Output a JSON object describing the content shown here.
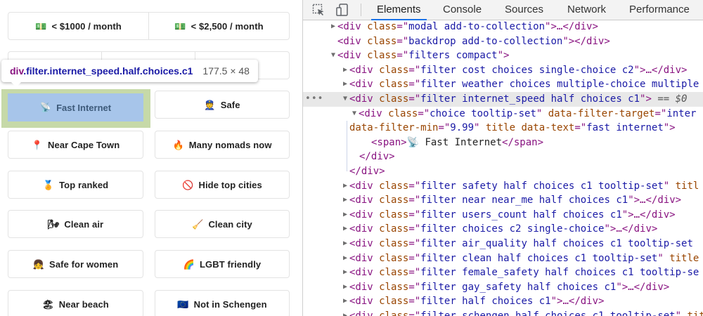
{
  "page": {
    "filters": [
      {
        "id": "cost1",
        "icon": "💵",
        "label": "< $1000 / month"
      },
      {
        "id": "cost2",
        "icon": "💵",
        "label": "< $2,500 / month"
      },
      {
        "id": "fast-internet",
        "icon": "📡",
        "label": "Fast Internet"
      },
      {
        "id": "safe",
        "icon": "👮",
        "label": "Safe"
      },
      {
        "id": "near-cape-town",
        "icon": "📍",
        "label": "Near Cape Town"
      },
      {
        "id": "many-nomads",
        "icon": "🔥",
        "label": "Many nomads now"
      },
      {
        "id": "top-ranked",
        "icon": "🏅",
        "label": "Top ranked"
      },
      {
        "id": "hide-top-cities",
        "icon": "🚫",
        "label": "Hide top cities"
      },
      {
        "id": "clean-air",
        "icon": "🌬",
        "label": "Clean air"
      },
      {
        "id": "clean-city",
        "icon": "🧹",
        "label": "Clean city"
      },
      {
        "id": "safe-for-women",
        "icon": "👧",
        "label": "Safe for women"
      },
      {
        "id": "lgbt-friendly",
        "icon": "🌈",
        "label": "LGBT friendly"
      },
      {
        "id": "near-beach",
        "icon": "🏖",
        "label": "Near beach"
      },
      {
        "id": "not-in-schengen",
        "icon": "🇪🇺",
        "label": "Not in Schengen"
      }
    ]
  },
  "inspect_tooltip": {
    "tag": "div",
    "classes": ".filter.internet_speed.half.choices.c1",
    "dimensions": "177.5 × 48"
  },
  "devtools": {
    "tabs": [
      "Elements",
      "Console",
      "Sources",
      "Network",
      "Performance"
    ],
    "active_tab": "Elements",
    "dom_lines": [
      {
        "indent": 1,
        "tri": "right",
        "parts": [
          [
            "t",
            "<div "
          ],
          [
            "an",
            "class"
          ],
          [
            "t",
            "=\""
          ],
          [
            "av",
            "modal add-to-collection"
          ],
          [
            "t",
            "\">…</div>"
          ]
        ]
      },
      {
        "indent": 1,
        "tri": "",
        "parts": [
          [
            "t",
            "<div "
          ],
          [
            "an",
            "class"
          ],
          [
            "t",
            "=\""
          ],
          [
            "av",
            "backdrop add-to-collection"
          ],
          [
            "t",
            "\"></div>"
          ]
        ]
      },
      {
        "indent": 0,
        "tri": "down",
        "parts": [
          [
            "t",
            "<div "
          ],
          [
            "an",
            "class"
          ],
          [
            "t",
            "=\""
          ],
          [
            "av",
            "filters compact"
          ],
          [
            "t",
            "\">"
          ]
        ]
      },
      {
        "indent": 2,
        "tri": "right",
        "parts": [
          [
            "t",
            "<div "
          ],
          [
            "an",
            "class"
          ],
          [
            "t",
            "=\""
          ],
          [
            "av",
            "filter cost choices single-choice c2"
          ],
          [
            "t",
            "\">…</div>"
          ]
        ]
      },
      {
        "indent": 2,
        "tri": "right",
        "parts": [
          [
            "t",
            "<div "
          ],
          [
            "an",
            "class"
          ],
          [
            "t",
            "=\""
          ],
          [
            "av",
            "filter weather choices multiple-choice multiple"
          ]
        ]
      },
      {
        "indent": 2,
        "tri": "down",
        "selected": true,
        "parts": [
          [
            "t",
            "<div "
          ],
          [
            "an",
            "class"
          ],
          [
            "t",
            "=\""
          ],
          [
            "av",
            "filter internet_speed half choices c1"
          ],
          [
            "t",
            "\">"
          ],
          [
            "eq",
            " == $0"
          ]
        ]
      },
      {
        "indent": 3,
        "tri": "down",
        "parts": [
          [
            "t",
            "<div "
          ],
          [
            "an",
            "class"
          ],
          [
            "t",
            "=\""
          ],
          [
            "av",
            "choice tooltip-set"
          ],
          [
            "t",
            "\" "
          ],
          [
            "an",
            "data-filter-target"
          ],
          [
            "t",
            "=\""
          ],
          [
            "av",
            "inter"
          ]
        ]
      },
      {
        "indent": 4,
        "tri": "",
        "parts": [
          [
            "an",
            "data-filter-min"
          ],
          [
            "t",
            "=\""
          ],
          [
            "av",
            "9.99"
          ],
          [
            "t",
            "\" "
          ],
          [
            "an",
            "title data-text"
          ],
          [
            "t",
            "=\""
          ],
          [
            "av",
            "fast internet"
          ],
          [
            "t",
            "\">"
          ]
        ]
      },
      {
        "indent": 5,
        "tri": "",
        "parts": [
          [
            "t",
            "<span>"
          ],
          [
            "x",
            "📡 Fast Internet"
          ],
          [
            "t",
            "</span>"
          ]
        ]
      },
      {
        "indent": 6,
        "tri": "",
        "parts": [
          [
            "t",
            "</div>"
          ]
        ]
      },
      {
        "indent": 7,
        "tri": "",
        "parts": [
          [
            "t",
            "</div>"
          ]
        ]
      },
      {
        "indent": 2,
        "tri": "right",
        "parts": [
          [
            "t",
            "<div "
          ],
          [
            "an",
            "class"
          ],
          [
            "t",
            "=\""
          ],
          [
            "av",
            "filter safety half choices c1 tooltip-set"
          ],
          [
            "t",
            "\" "
          ],
          [
            "an",
            "titl"
          ]
        ]
      },
      {
        "indent": 2,
        "tri": "right",
        "parts": [
          [
            "t",
            "<div "
          ],
          [
            "an",
            "class"
          ],
          [
            "t",
            "=\""
          ],
          [
            "av",
            "filter near near_me half choices c1"
          ],
          [
            "t",
            "\">…</div>"
          ]
        ]
      },
      {
        "indent": 2,
        "tri": "right",
        "parts": [
          [
            "t",
            "<div "
          ],
          [
            "an",
            "class"
          ],
          [
            "t",
            "=\""
          ],
          [
            "av",
            "filter users_count half choices c1"
          ],
          [
            "t",
            "\">…</div>"
          ]
        ]
      },
      {
        "indent": 2,
        "tri": "right",
        "parts": [
          [
            "t",
            "<div "
          ],
          [
            "an",
            "class"
          ],
          [
            "t",
            "=\""
          ],
          [
            "av",
            "filter choices c2 single-choice"
          ],
          [
            "t",
            "\">…</div>"
          ]
        ]
      },
      {
        "indent": 2,
        "tri": "right",
        "parts": [
          [
            "t",
            "<div "
          ],
          [
            "an",
            "class"
          ],
          [
            "t",
            "=\""
          ],
          [
            "av",
            "filter air_quality half choices c1 tooltip-set"
          ]
        ]
      },
      {
        "indent": 2,
        "tri": "right",
        "parts": [
          [
            "t",
            "<div "
          ],
          [
            "an",
            "class"
          ],
          [
            "t",
            "=\""
          ],
          [
            "av",
            "filter clean half choices c1 tooltip-set"
          ],
          [
            "t",
            "\" "
          ],
          [
            "an",
            "title"
          ]
        ]
      },
      {
        "indent": 2,
        "tri": "right",
        "parts": [
          [
            "t",
            "<div "
          ],
          [
            "an",
            "class"
          ],
          [
            "t",
            "=\""
          ],
          [
            "av",
            "filter female_safety half choices c1 tooltip-se"
          ]
        ]
      },
      {
        "indent": 2,
        "tri": "right",
        "parts": [
          [
            "t",
            "<div "
          ],
          [
            "an",
            "class"
          ],
          [
            "t",
            "=\""
          ],
          [
            "av",
            "filter gay_safety half choices c1"
          ],
          [
            "t",
            "\">…</div>"
          ]
        ]
      },
      {
        "indent": 2,
        "tri": "right",
        "parts": [
          [
            "t",
            "<div "
          ],
          [
            "an",
            "class"
          ],
          [
            "t",
            "=\""
          ],
          [
            "av",
            "filter half choices c1"
          ],
          [
            "t",
            "\">…</div>"
          ]
        ]
      },
      {
        "indent": 2,
        "tri": "right",
        "parts": [
          [
            "t",
            "<div "
          ],
          [
            "an",
            "class"
          ],
          [
            "t",
            "=\""
          ],
          [
            "av",
            "filter schengen half choices c1 tooltip-set"
          ],
          [
            "t",
            "\" "
          ],
          [
            "an",
            "title"
          ]
        ]
      }
    ]
  }
}
